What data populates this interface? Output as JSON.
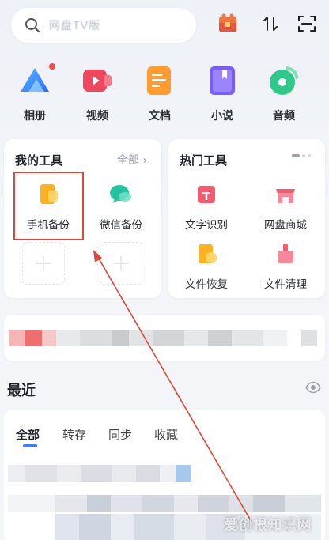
{
  "search": {
    "placeholder": "网盘TV版"
  },
  "shortcuts": [
    {
      "label": "相册",
      "icon": "album-icon"
    },
    {
      "label": "视频",
      "icon": "video-icon"
    },
    {
      "label": "文档",
      "icon": "document-icon"
    },
    {
      "label": "小说",
      "icon": "novel-icon"
    },
    {
      "label": "音频",
      "icon": "audio-icon"
    }
  ],
  "my_tools": {
    "title": "我的工具",
    "all_label": "全部",
    "items": [
      {
        "label": "手机备份",
        "icon": "phone-backup-icon"
      },
      {
        "label": "微信备份",
        "icon": "wechat-backup-icon"
      }
    ]
  },
  "hot_tools": {
    "title": "热门工具",
    "items": [
      {
        "label": "文字识别",
        "icon": "ocr-icon"
      },
      {
        "label": "网盘商城",
        "icon": "store-icon"
      },
      {
        "label": "文件恢复",
        "icon": "file-restore-icon"
      },
      {
        "label": "文件清理",
        "icon": "file-clean-icon"
      }
    ]
  },
  "recent": {
    "title": "最近",
    "tabs": [
      "全部",
      "转存",
      "同步",
      "收藏"
    ],
    "active_tab": "全部"
  },
  "watermark": "爱创根知识网",
  "colors": {
    "accent": "#3d7bff",
    "annotation_red": "#d94a3a"
  }
}
